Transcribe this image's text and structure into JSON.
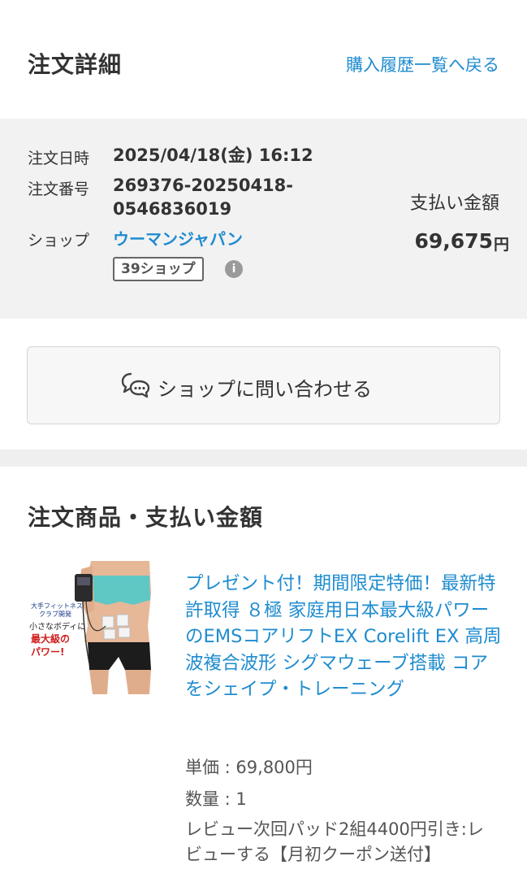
{
  "header": {
    "title": "注文詳細",
    "back_link": "購入履歴一覧へ戻る"
  },
  "order": {
    "date_label": "注文日時",
    "date_value": "2025/04/18(金) 16:12",
    "number_label": "注文番号",
    "number_line1": "269376-20250418-",
    "number_line2": "0546836019",
    "shop_label": "ショップ",
    "shop_name": "ウーマンジャパン",
    "shop_badge": "39ショップ",
    "info_icon": "i",
    "payment_label": "支払い金額",
    "payment_amount": "69,675",
    "payment_unit": "円"
  },
  "contact": {
    "label": "ショップに問い合わせる",
    "icon": "chat-bubble-icon"
  },
  "items_section": {
    "title": "注文商品・支払い金額",
    "product": {
      "image_text_1": "大手フィットネス",
      "image_text_2": "クラブ開発",
      "image_text_3": "小さなボディに",
      "image_text_4": "最大級の",
      "image_text_5": "パワー!",
      "name": "プレゼント付！期間限定特価！最新特許取得 ８極 家庭用日本最大級パワーのEMSコアリフトEX Corelift EX 高周波複合波形 シグマウェーブ搭載 コアをシェイプ・トレーニング",
      "unit_price": "単価 : 69,800円",
      "quantity": "数量 : 1",
      "note": "レビュー次回パッド2組4400円引き:レビューする【月初クーポン送付】"
    }
  },
  "colors": {
    "link": "#1f8ccf",
    "panel_bg": "#f2f2f2",
    "text": "#333333"
  }
}
